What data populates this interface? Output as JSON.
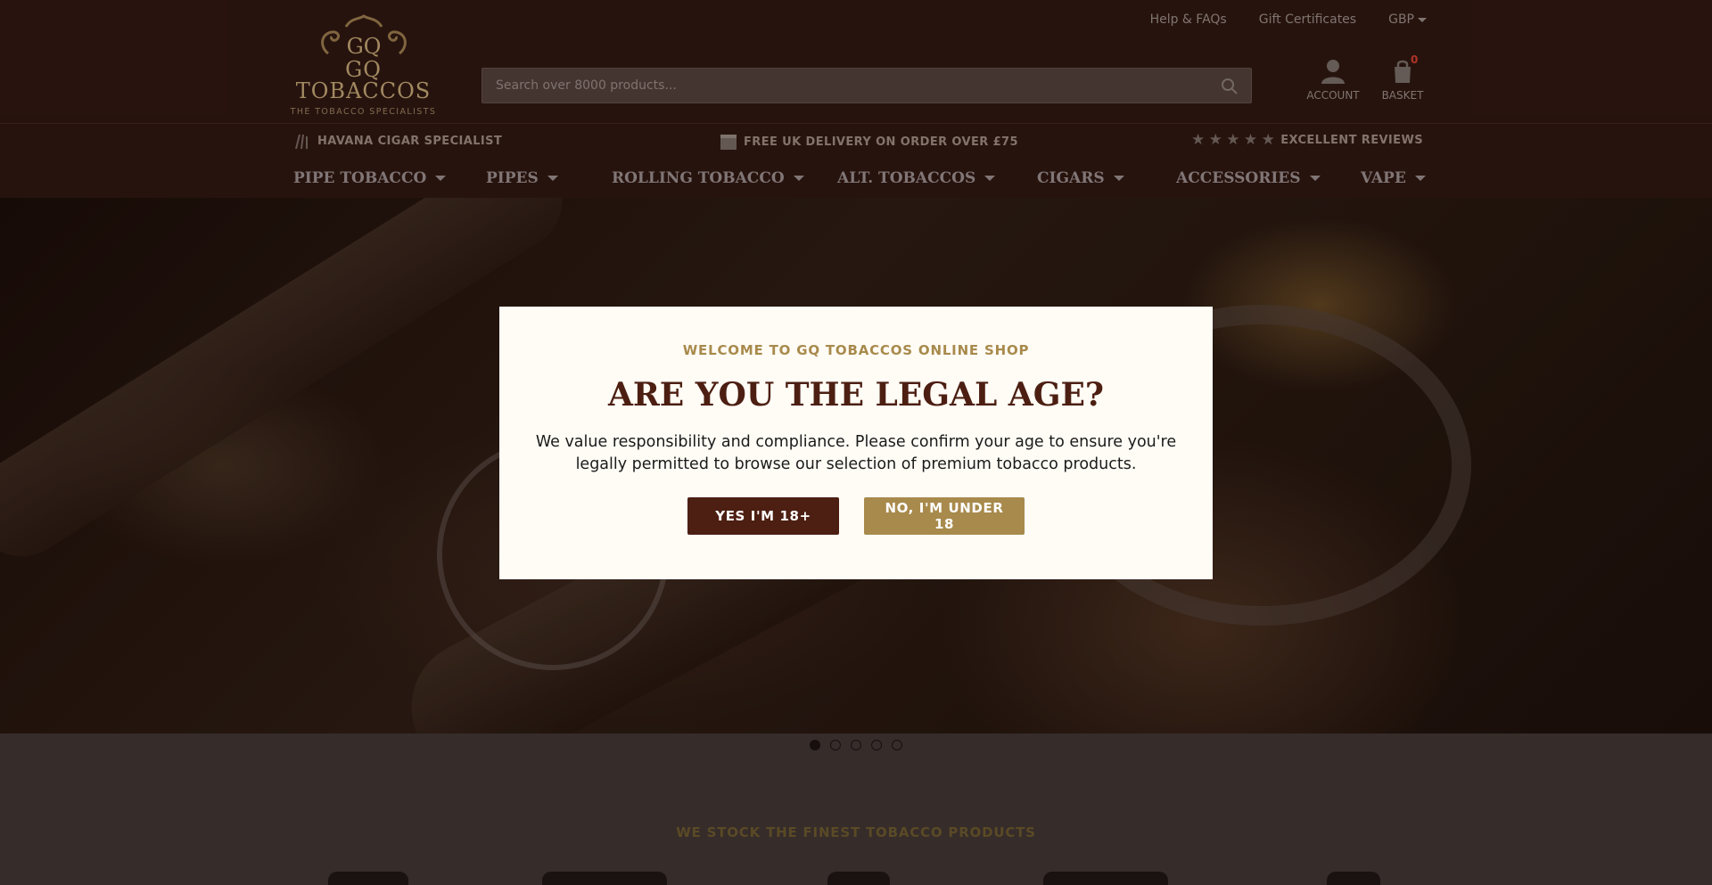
{
  "header": {
    "logo": {
      "name": "GQ TOBACCOS",
      "tagline": "THE TOBACCO SPECIALISTS",
      "monogram": "GQ"
    },
    "search": {
      "placeholder": "Search over 8000 products...",
      "icon": "search-icon"
    },
    "toplinks": {
      "help": "Help & FAQs",
      "gift": "Gift Certificates",
      "currency": "GBP"
    },
    "account_label": "ACCOUNT",
    "basket_label": "BASKET",
    "basket_count": "0"
  },
  "usp": {
    "havana": "HAVANA CIGAR SPECIALIST",
    "delivery": "FREE UK DELIVERY ON ORDER OVER £75",
    "reviews": "EXCELLENT REVIEWS",
    "stars": "★",
    "star_count": 5
  },
  "nav": {
    "items": [
      {
        "label": "PIPE TOBACCO"
      },
      {
        "label": "PIPES"
      },
      {
        "label": "ROLLING TOBACCO"
      },
      {
        "label": "ALT. TOBACCOS"
      },
      {
        "label": "CIGARS"
      },
      {
        "label": "ACCESSORIES"
      },
      {
        "label": "VAPE"
      }
    ]
  },
  "carousel": {
    "slide_count": 5,
    "active_index": 0
  },
  "brands_section": {
    "title": "WE STOCK THE FINEST TOBACCO PRODUCTS"
  },
  "modal": {
    "eyebrow": "WELCOME TO GQ TOBACCOS ONLINE SHOP",
    "title": "ARE YOU THE LEGAL AGE?",
    "text": "We value responsibility and compliance. Please confirm your age to ensure you're legally permitted to browse our selection of premium tobacco products.",
    "yes_label": "YES I'M 18+",
    "no_label": "NO, I'M UNDER 18"
  },
  "colors": {
    "header_bg": "#2b1510",
    "modal_bg": "#fffcf5",
    "brand_dark": "#4c1f12",
    "brand_gold": "#a88a4c"
  }
}
